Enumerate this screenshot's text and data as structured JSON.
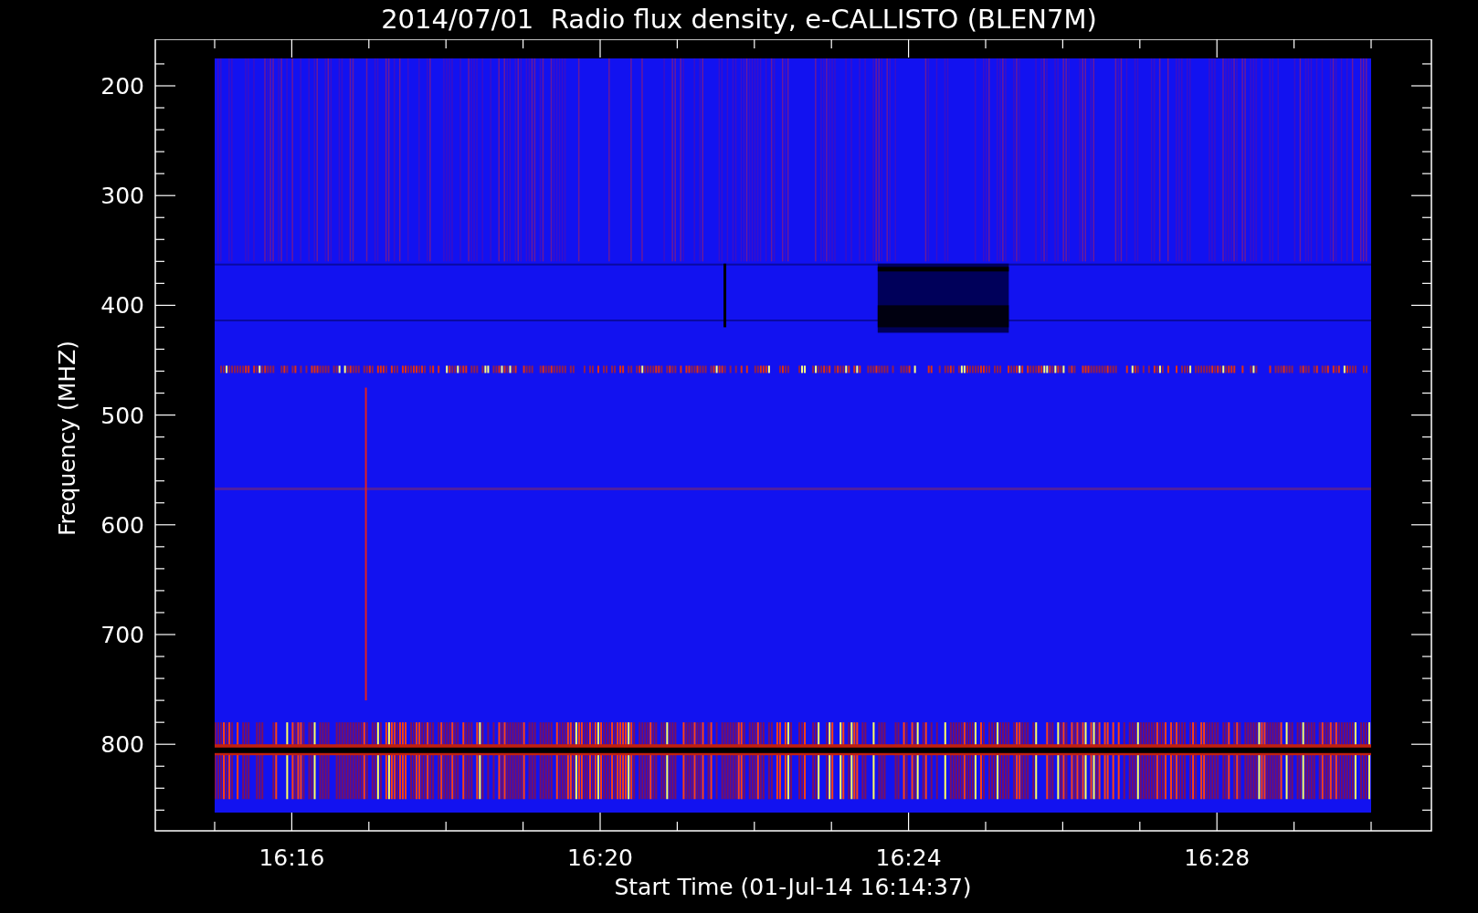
{
  "title": "2014/07/01  Radio flux density, e-CALLISTO (BLEN7M)",
  "x_axis": {
    "label": "Start Time (01-Jul-14 16:14:37)",
    "ticks": [
      "16:16",
      "16:20",
      "16:24",
      "16:28"
    ]
  },
  "y_axis": {
    "label": "Frequency (MHZ)",
    "ticks": [
      "200",
      "300",
      "400",
      "500",
      "600",
      "700",
      "800"
    ]
  }
}
